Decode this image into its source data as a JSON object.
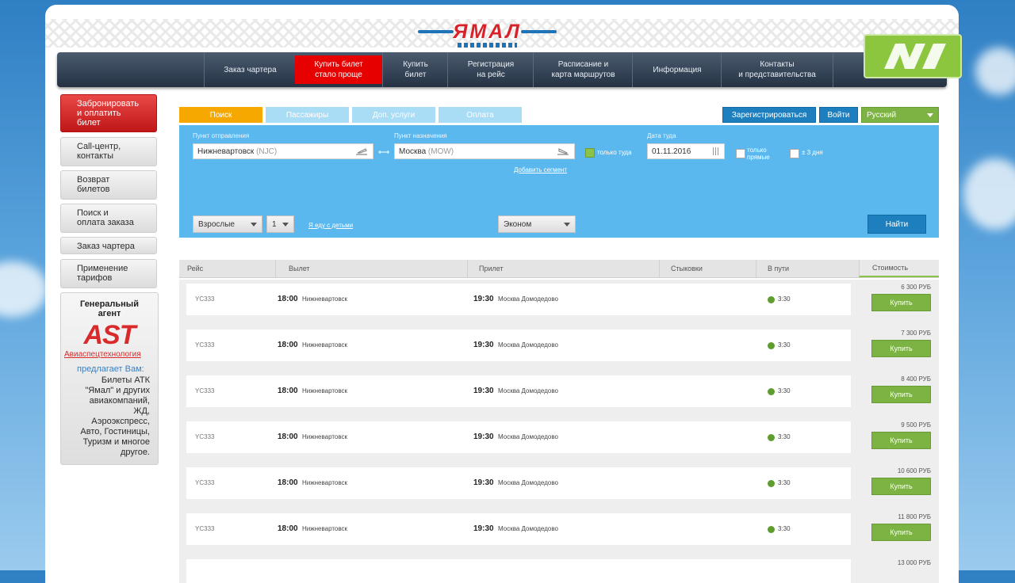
{
  "brand": {
    "logo_text": "ЯМАЛ"
  },
  "nav": [
    {
      "label": "Заказ чартера"
    },
    {
      "label": "Купить билет\nстало проще"
    },
    {
      "label": "Купить\nбилет"
    },
    {
      "label": "Регистрация\nна рейс"
    },
    {
      "label": "Расписание и\nкарта маршрутов"
    },
    {
      "label": "Информация"
    },
    {
      "label": "Контакты\nи представительства"
    }
  ],
  "sidebar": {
    "items": [
      {
        "label": "Забронировать\nи оплатить\nбилет"
      },
      {
        "label": "Call-центр,\nконтакты"
      },
      {
        "label": "Возврат\nбилетов"
      },
      {
        "label": "Поиск и\nоплата заказа"
      },
      {
        "label": "Заказ чартера"
      },
      {
        "label": "Применение\nтарифов"
      }
    ],
    "agent": {
      "title": "Генеральный\nагент",
      "logo": "AST",
      "name": "Авиаспецтехнология",
      "offer": "предлагает Вам:",
      "text": "Билеты АТК\n\"Ямал\" и других\nавиакомпаний,\nЖД,\nАэроэкспресс,\nАвто, Гостиницы,\nТуризм и многое\nдругое."
    }
  },
  "steps": [
    {
      "label": "Поиск",
      "color": "#f6a800"
    },
    {
      "label": "Пассажиры",
      "color": "#a9dcf5"
    },
    {
      "label": "Доп. услуги",
      "color": "#a9dcf5"
    },
    {
      "label": "Оплата",
      "color": "#a9dcf5"
    }
  ],
  "account": {
    "register": "Зарегистрироваться",
    "login": "Войти",
    "language": "Русский"
  },
  "search": {
    "from_label": "Пункт отправления",
    "from_city": "Нижневартовск",
    "from_code": "(NJC)",
    "to_label": "Пункт назначения",
    "to_city": "Москва",
    "to_code": "(MOW)",
    "oneway_label": "только туда",
    "add_segment": "Добавить сегмент",
    "date_label": "Дата туда",
    "date_value": "01.11.2016",
    "direct_label": "только\nпрямые",
    "flex_label": "± 3 дня",
    "passenger_type": "Взрослые",
    "passenger_count": "1",
    "kids_link": "Я еду с детьми",
    "cabin": "Эконом",
    "find": "Найти"
  },
  "results": {
    "columns": [
      "Рейс",
      "Вылет",
      "Прилет",
      "Стыковки",
      "В пути",
      "Стоимость"
    ],
    "buy_label": "Купить",
    "rows": [
      {
        "flight": "YC333",
        "dep_time": "18:00",
        "dep_city": "Нижневартовск",
        "arr_time": "19:30",
        "arr_city": "Москва Домодедово",
        "duration": "3:30",
        "price": "6 300 РУБ"
      },
      {
        "flight": "YC333",
        "dep_time": "18:00",
        "dep_city": "Нижневартовск",
        "arr_time": "19:30",
        "arr_city": "Москва Домодедово",
        "duration": "3:30",
        "price": "7 300 РУБ"
      },
      {
        "flight": "YC333",
        "dep_time": "18:00",
        "dep_city": "Нижневартовск",
        "arr_time": "19:30",
        "arr_city": "Москва Домодедово",
        "duration": "3:30",
        "price": "8 400 РУБ"
      },
      {
        "flight": "YC333",
        "dep_time": "18:00",
        "dep_city": "Нижневартовск",
        "arr_time": "19:30",
        "arr_city": "Москва Домодедово",
        "duration": "3:30",
        "price": "9 500 РУБ"
      },
      {
        "flight": "YC333",
        "dep_time": "18:00",
        "dep_city": "Нижневартовск",
        "arr_time": "19:30",
        "arr_city": "Москва Домодедово",
        "duration": "3:30",
        "price": "10 600 РУБ"
      },
      {
        "flight": "YC333",
        "dep_time": "18:00",
        "dep_city": "Нижневартовск",
        "arr_time": "19:30",
        "arr_city": "Москва Домодедово",
        "duration": "3:30",
        "price": "11 800 РУБ"
      },
      {
        "price": "13 000 РУБ"
      }
    ]
  }
}
